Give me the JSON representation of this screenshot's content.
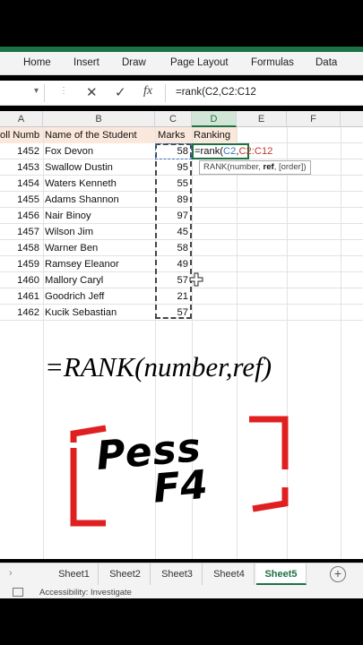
{
  "ribbon": {
    "tabs": [
      "Home",
      "Insert",
      "Draw",
      "Page Layout",
      "Formulas",
      "Data"
    ]
  },
  "formula_bar": {
    "cancel_icon": "✕",
    "enter_icon": "✓",
    "fx_icon": "fx",
    "formula": "=rank(C2,C2:C12"
  },
  "columns": [
    "A",
    "B",
    "C",
    "D",
    "E",
    "F"
  ],
  "header_row": {
    "a": "oll Numb",
    "b": "Name of the Student",
    "c": "Marks",
    "d": "Ranking"
  },
  "rows": [
    {
      "roll": "1452",
      "name": "Fox Devon",
      "marks": "58"
    },
    {
      "roll": "1453",
      "name": "Swallow Dustin",
      "marks": "95"
    },
    {
      "roll": "1454",
      "name": "Waters Kenneth",
      "marks": "55"
    },
    {
      "roll": "1455",
      "name": "Adams Shannon",
      "marks": "89"
    },
    {
      "roll": "1456",
      "name": "Nair Binoy",
      "marks": "97"
    },
    {
      "roll": "1457",
      "name": "Wilson Jim",
      "marks": "45"
    },
    {
      "roll": "1458",
      "name": "Warner Ben",
      "marks": "58"
    },
    {
      "roll": "1459",
      "name": "Ramsey Eleanor",
      "marks": "49"
    },
    {
      "roll": "1460",
      "name": "Mallory Caryl",
      "marks": "57"
    },
    {
      "roll": "1461",
      "name": "Goodrich Jeff",
      "marks": "21"
    },
    {
      "roll": "1462",
      "name": "Kucik Sebastian",
      "marks": "57"
    }
  ],
  "active_cell": {
    "prefix": "=rank(",
    "ref1": "C2",
    "comma": ",",
    "ref2": "C2:C12"
  },
  "tooltip": {
    "fn": "RANK(number, ",
    "bold": "ref",
    "rest": ", [order])"
  },
  "overlay": {
    "formula_caption": "=RANK(number,ref)",
    "press_line1": "Pess",
    "press_line2": "F4"
  },
  "sheet_tabs": [
    "Sheet1",
    "Sheet2",
    "Sheet3",
    "Sheet4",
    "Sheet5"
  ],
  "active_sheet": "Sheet5",
  "status": {
    "accessibility": "Accessibility: Investigate"
  },
  "colors": {
    "excel_green": "#1e7145",
    "header_fill": "#fbe8dc",
    "accent_red": "#e02020"
  }
}
